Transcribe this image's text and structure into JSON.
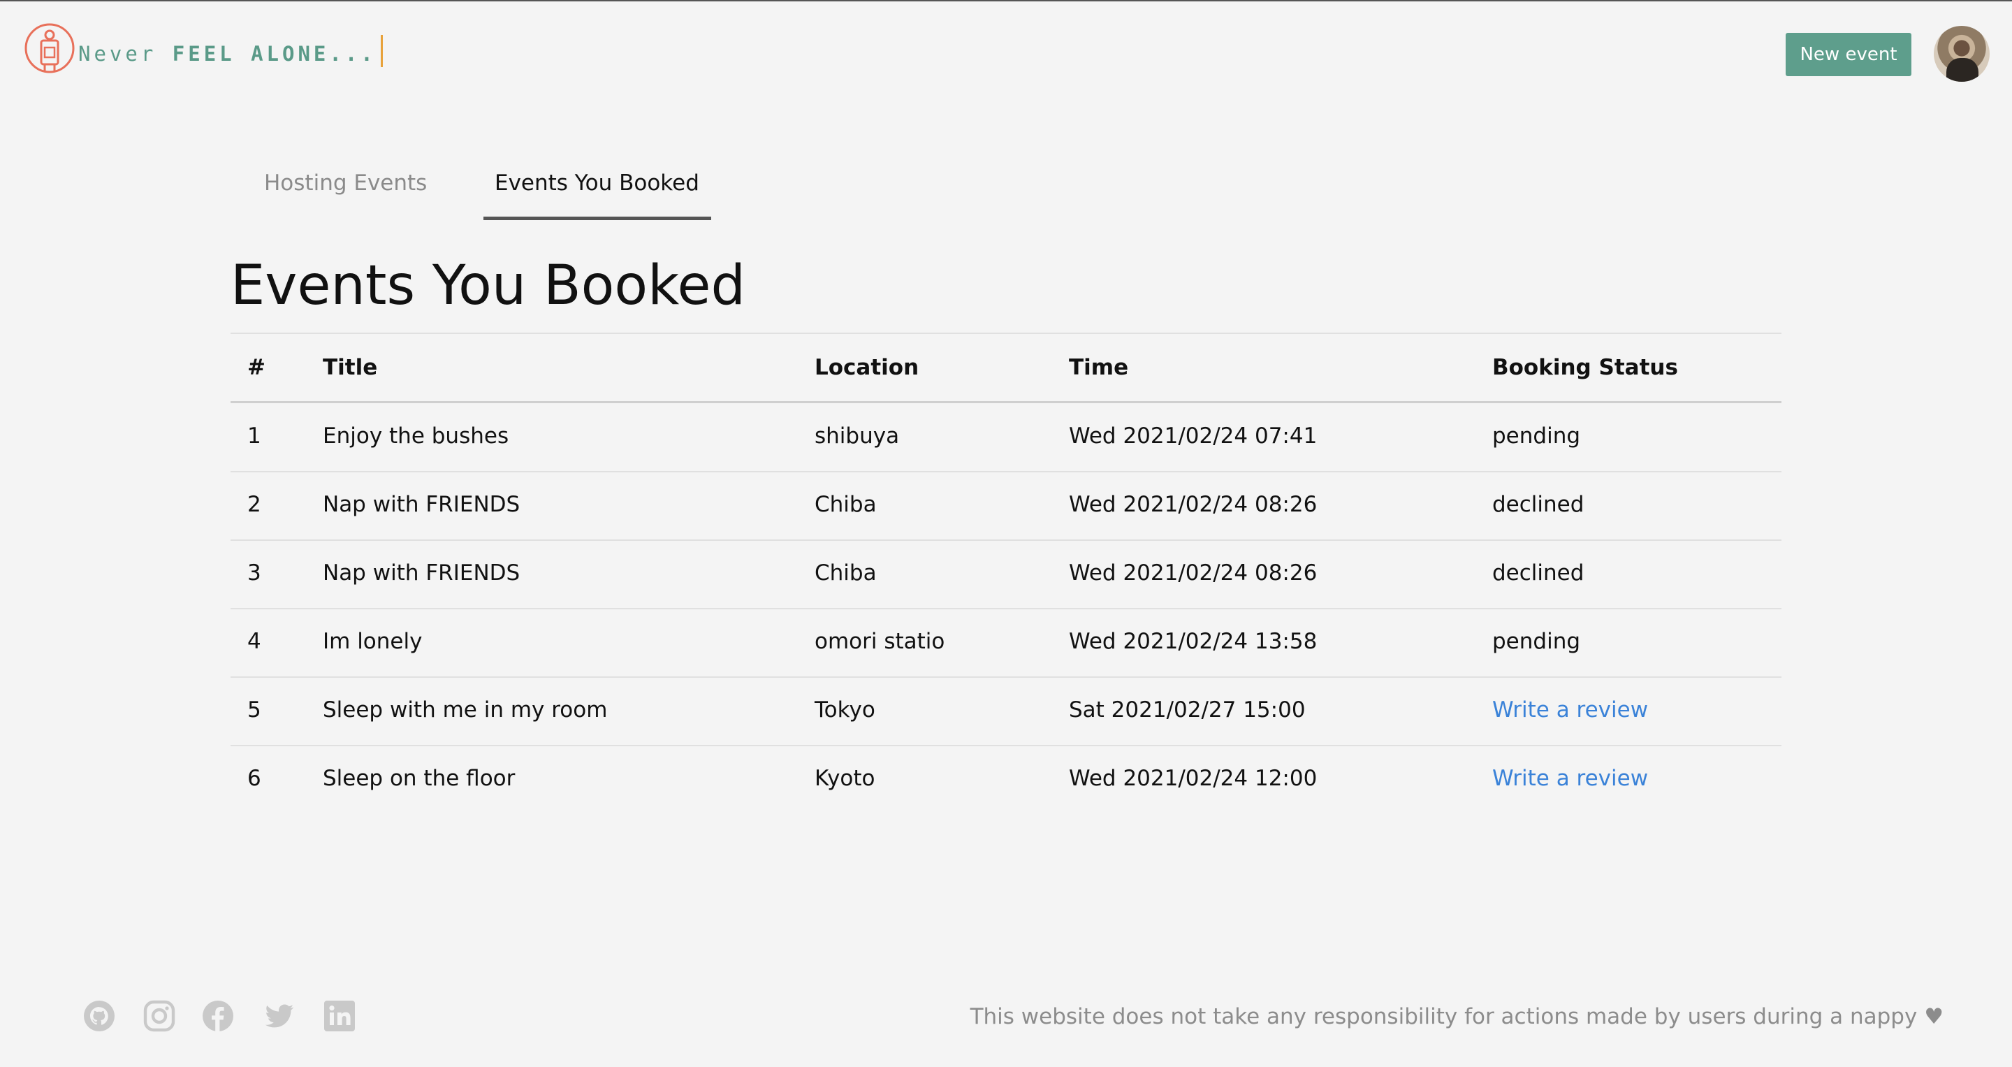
{
  "header": {
    "brand_word1": "Never",
    "brand_word2": "FEEL ALONE...",
    "new_event_label": "New event",
    "accent_color": "#5e9e8c",
    "logo_color": "#e8705a"
  },
  "tabs": [
    {
      "label": "Hosting Events",
      "active": false
    },
    {
      "label": "Events You Booked",
      "active": true
    }
  ],
  "page_title": "Events You Booked",
  "table": {
    "headers": [
      "#",
      "Title",
      "Location",
      "Time",
      "Booking Status"
    ],
    "rows": [
      {
        "num": "1",
        "title": "Enjoy the bushes",
        "location": "shibuya",
        "time": "Wed 2021/02/24 07:41",
        "status": "pending"
      },
      {
        "num": "2",
        "title": "Nap with FRIENDS",
        "location": "Chiba",
        "time": "Wed 2021/02/24 08:26",
        "status": "declined"
      },
      {
        "num": "3",
        "title": "Nap with FRIENDS",
        "location": "Chiba",
        "time": "Wed 2021/02/24 08:26",
        "status": "declined"
      },
      {
        "num": "4",
        "title": "Im lonely",
        "location": "omori statio",
        "time": "Wed 2021/02/24 13:58",
        "status": "pending"
      },
      {
        "num": "5",
        "title": "Sleep with me in my room",
        "location": "Tokyo",
        "time": "Sat 2021/02/27 15:00",
        "status": "Write a review"
      },
      {
        "num": "6",
        "title": "Sleep on the floor",
        "location": "Kyoto",
        "time": "Wed 2021/02/24 12:00",
        "status": "Write a review"
      }
    ]
  },
  "footer": {
    "social_icons": [
      "github-icon",
      "instagram-icon",
      "facebook-icon",
      "twitter-icon",
      "linkedin-icon"
    ],
    "disclaimer": "This website does not take any responsibility for actions made by users during a nappy",
    "heart": "♥"
  }
}
